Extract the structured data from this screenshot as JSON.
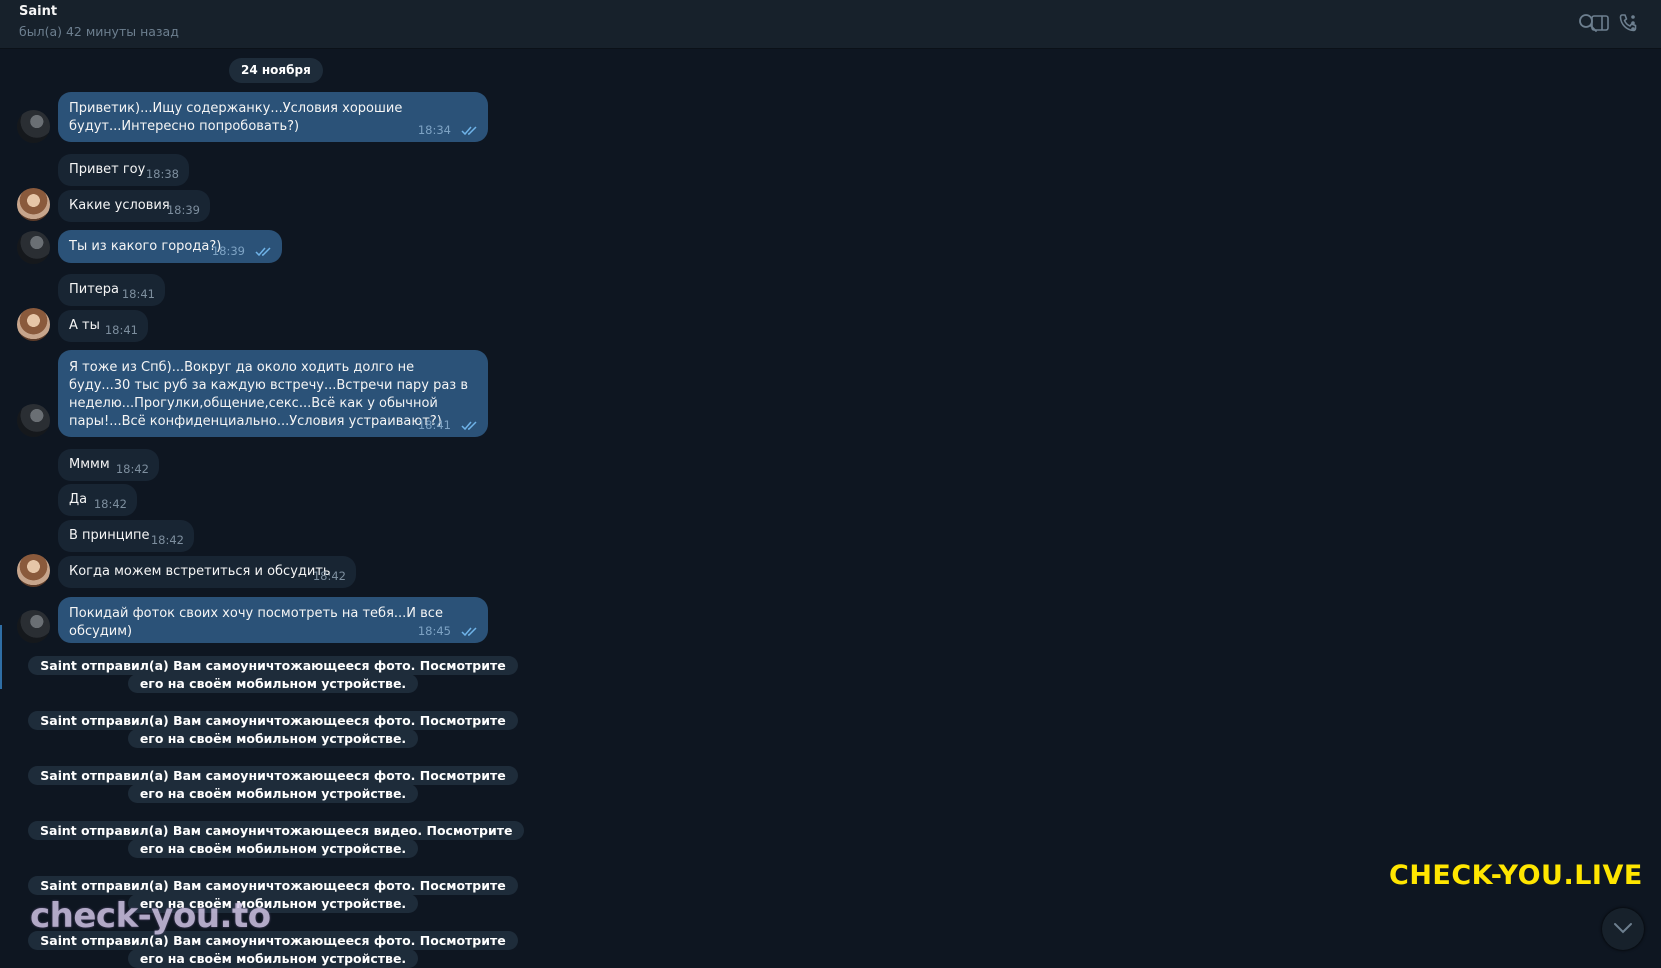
{
  "header": {
    "title": "Saint",
    "status": "был(а) 42 минуты назад",
    "icons": [
      "search-icon",
      "phone-icon",
      "sidebar-toggle-icon",
      "more-vertical-icon"
    ]
  },
  "date_separator": "24 ноября",
  "messages": [
    {
      "dir": "out",
      "text": "Приветик)...Ищу содержанку...Условия хорошие будут...Интересно попробовать?)",
      "time": "18:34"
    },
    {
      "dir": "in",
      "text": "Привет гоу",
      "time": "18:38"
    },
    {
      "dir": "in",
      "text": "Какие условия",
      "time": "18:39"
    },
    {
      "dir": "out",
      "text": "Ты из какого города?)",
      "time": "18:39"
    },
    {
      "dir": "in",
      "text": "Питера",
      "time": "18:41"
    },
    {
      "dir": "in",
      "text": "А ты",
      "time": "18:41"
    },
    {
      "dir": "out",
      "text": "Я тоже из Спб)...Вокруг да около ходить долго не буду...30 тыс руб за каждую встречу...Встречи пару раз в неделю...Прогулки,общение,секс...Всё как у обычной пары!...Всё конфиденциально...Условия устраивают?)",
      "time": "18:41"
    },
    {
      "dir": "in",
      "text": "Мммм",
      "time": "18:42"
    },
    {
      "dir": "in",
      "text": "Да",
      "time": "18:42"
    },
    {
      "dir": "in",
      "text": "В принципе",
      "time": "18:42"
    },
    {
      "dir": "in",
      "text": "Когда можем встретиться и обсудить",
      "time": "18:42"
    },
    {
      "dir": "out",
      "text": "Покидай фоток своих хочу посмотреть на тебя...И все обсудим)",
      "time": "18:45"
    }
  ],
  "service_messages": [
    "Saint отправил(а) Вам самоуничтожающееся фото. Посмотрите его на своём мобильном устройстве.",
    "Saint отправил(а) Вам самоуничтожающееся фото. Посмотрите его на своём мобильном устройстве.",
    "Saint отправил(а) Вам самоуничтожающееся фото. Посмотрите его на своём мобильном устройстве.",
    "Saint отправил(а) Вам самоуничтожающееся видео. Посмотрите его на своём мобильном устройстве.",
    "Saint отправил(а) Вам самоуничтожающееся фото. Посмотрите его на своём мобильном устройстве.",
    "Saint отправил(а) Вам самоуничтожающееся фото. Посмотрите его на своём мобильном устройстве."
  ],
  "watermarks": {
    "right": "CHECK-YOU.LIVE",
    "left": "check-you.to"
  },
  "colors": {
    "background": "#0e1621",
    "header": "#17212b",
    "incoming_bubble": "#182533",
    "outgoing_bubble": "#2b5278",
    "watermark_yellow": "#ffe600"
  }
}
